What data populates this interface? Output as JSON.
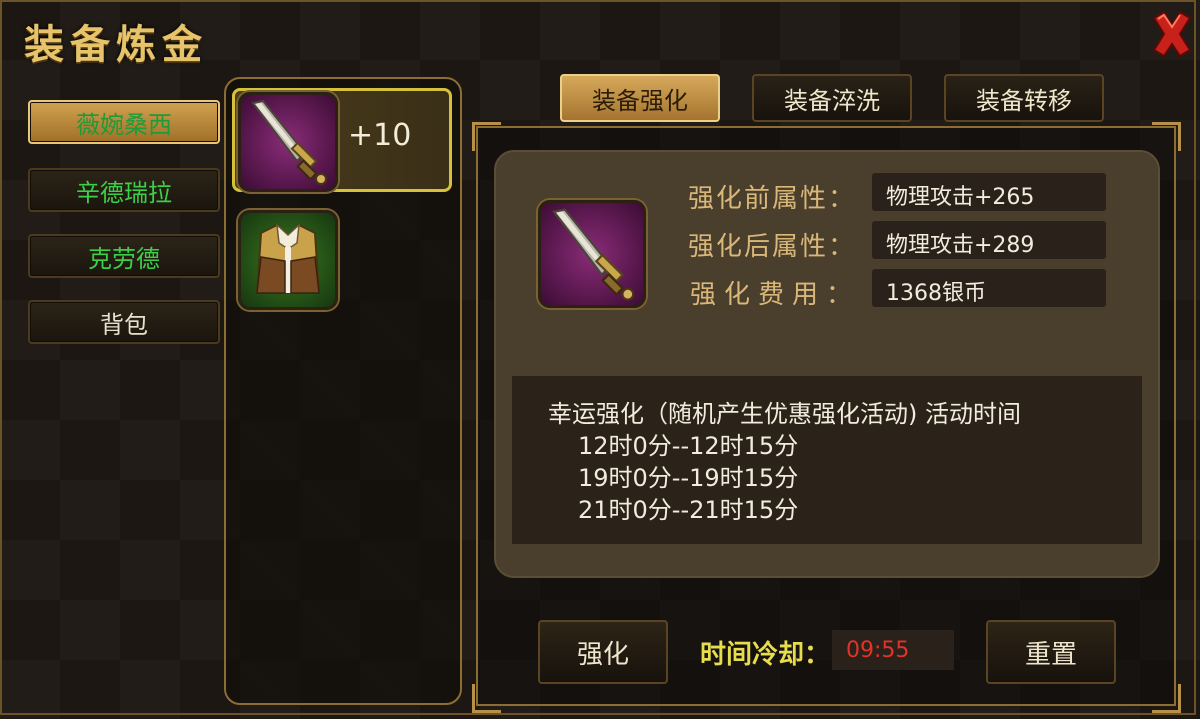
{
  "title": "装备炼金",
  "sidebar": {
    "items": [
      {
        "label": "薇婉桑西",
        "active": true
      },
      {
        "label": "辛德瑞拉",
        "active": false
      },
      {
        "label": "克劳德",
        "active": false
      },
      {
        "label": "背包",
        "active": false
      }
    ]
  },
  "inventory": {
    "items": [
      {
        "icon": "sword-icon",
        "level": "+10",
        "selected": true
      },
      {
        "icon": "armor-vest-icon",
        "level": "",
        "selected": false
      }
    ]
  },
  "tabs": [
    {
      "label": "装备强化",
      "active": true
    },
    {
      "label": "装备淬洗",
      "active": false
    },
    {
      "label": "装备转移",
      "active": false
    }
  ],
  "enhance": {
    "before_label": "强化前属性：",
    "before_value": "物理攻击+265",
    "after_label": "强化后属性：",
    "after_value": "物理攻击+289",
    "cost_label": "强化费用：",
    "cost_value": "1368银币",
    "item_icon": "sword-icon"
  },
  "info": {
    "headline": "幸运强化（随机产生优惠强化活动) 活动时间",
    "times": [
      "12时0分--12时15分",
      "19时0分--19时15分",
      "21时0分--21时15分"
    ]
  },
  "actions": {
    "enhance_label": "强化",
    "cooldown_label": "时间冷却：",
    "cooldown_value": "09:55",
    "reset_label": "重置"
  },
  "colors": {
    "gold": "#e7c46a",
    "active_green": "#3cd048",
    "cooldown_red": "#e0332a",
    "cooldown_label": "#e6dc4c"
  }
}
